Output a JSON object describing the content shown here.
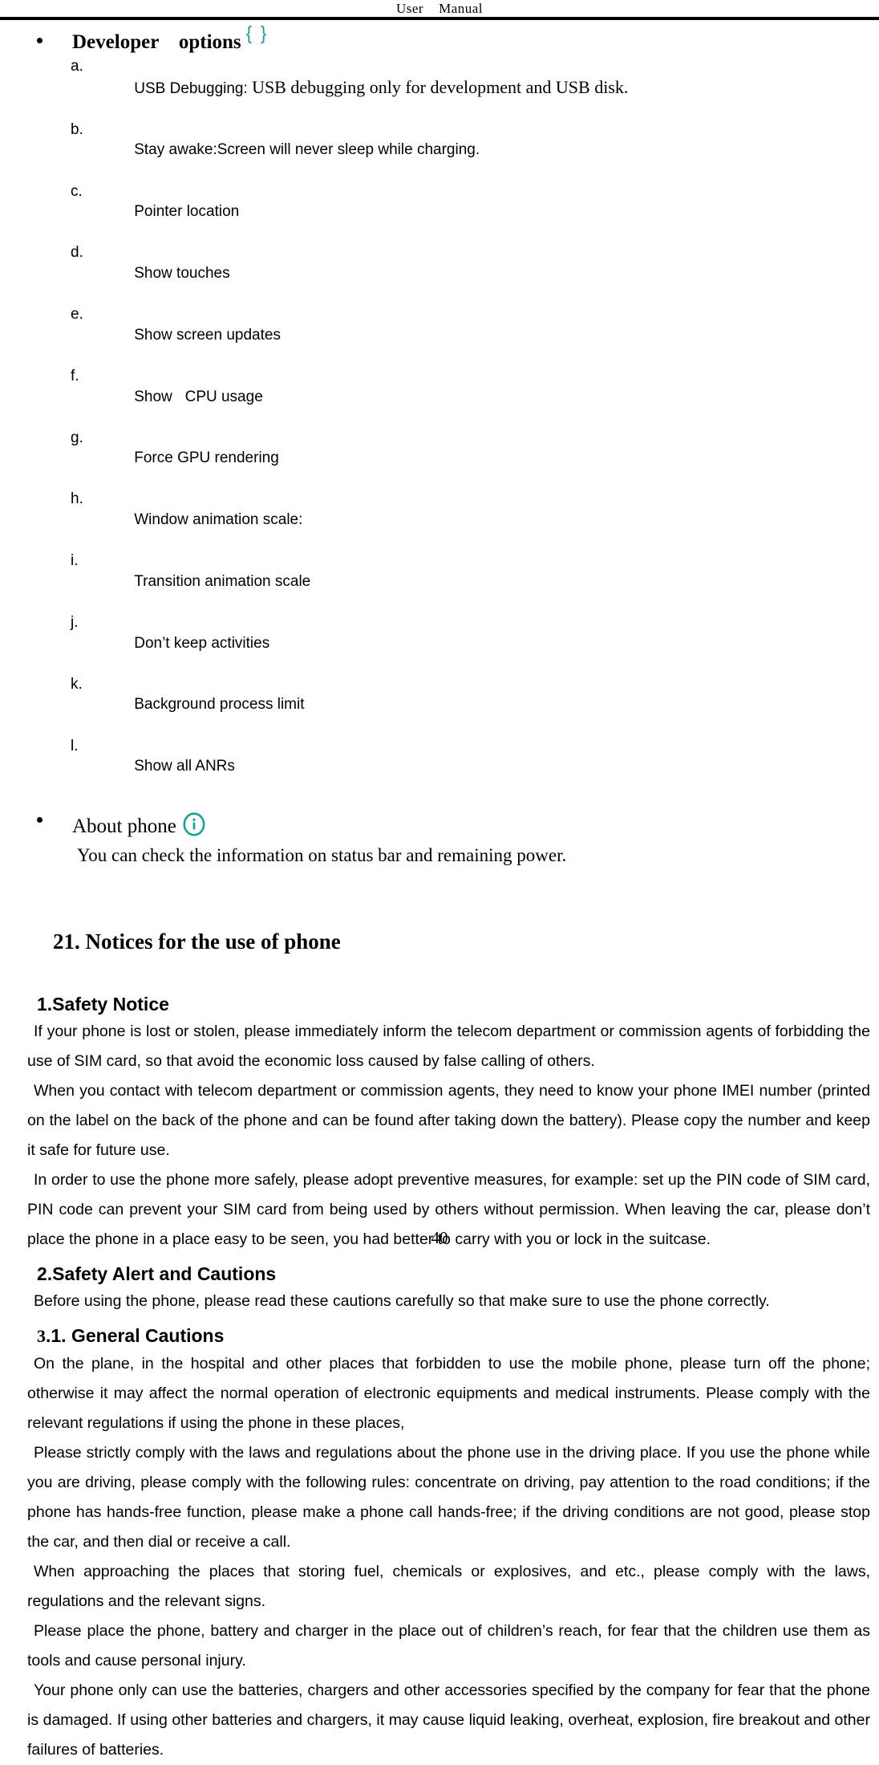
{
  "header": {
    "title": "User    Manual"
  },
  "developer_options": {
    "bullet_label": "Developer    options",
    "icon": "curly-braces-icon",
    "icon_glyph": "{ }",
    "icon_color": "#17a398",
    "items": [
      {
        "marker": "a.",
        "text_bold_part": "USB Debugging: ",
        "text_serif_part": "USB debugging only for development and USB disk."
      },
      {
        "marker": "b.",
        "text_bold_part": "Stay awake:Screen will never sleep while charging.",
        "text_serif_part": ""
      },
      {
        "marker": "c.",
        "text_bold_part": "Pointer location",
        "text_serif_part": ""
      },
      {
        "marker": "d.",
        "text_bold_part": "Show touches",
        "text_serif_part": ""
      },
      {
        "marker": "e.",
        "text_bold_part": "Show screen updates",
        "text_serif_part": ""
      },
      {
        "marker": "f.",
        "text_bold_part": "Show   CPU usage",
        "text_serif_part": ""
      },
      {
        "marker": "g.",
        "text_bold_part": "Force GPU rendering",
        "text_serif_part": ""
      },
      {
        "marker": "h.",
        "text_bold_part": "Window animation scale:",
        "text_serif_part": ""
      },
      {
        "marker": "i.",
        "text_bold_part": "Transition animation scale",
        "text_serif_part": ""
      },
      {
        "marker": "j.",
        "text_bold_part": "Don’t keep activities",
        "text_serif_part": ""
      },
      {
        "marker": "k.",
        "text_bold_part": "Background process limit",
        "text_serif_part": ""
      },
      {
        "marker": "l.",
        "text_bold_part": "Show all ANRs",
        "text_serif_part": ""
      }
    ]
  },
  "about_phone": {
    "bullet_label": "About phone",
    "icon": "info-circle-icon",
    "icon_color": "#17a398",
    "description": "You can check the information on status bar and remaining power."
  },
  "chapter": {
    "heading": "21. Notices for the use of phone"
  },
  "sections": {
    "safety_notice_heading": "1.Safety Notice",
    "safety_notice_p1": "If your phone is lost or stolen, please immediately inform the telecom department or commission agents of forbidding the use of SIM card, so that avoid the economic loss caused by false calling of others.",
    "safety_notice_p2": "When you contact with telecom department or commission agents, they need to know your phone IMEI number (printed on the label on the back of the phone and can be found after taking down the battery). Please copy the number and keep it safe for future use.",
    "safety_notice_p3": "In order to use the phone more safely, please adopt preventive measures, for example: set up the PIN code of SIM card, PIN code can prevent your SIM card from being used by others without permission. When leaving the car, please don’t place the phone in a place easy to be seen, you had better to carry with you or lock in the suitcase.",
    "safety_alert_heading": "2.Safety Alert and Cautions",
    "safety_alert_p1": "Before using the phone, please read these cautions carefully so that make sure to use the phone correctly.",
    "general_cautions_num": "3",
    "general_cautions_rest": ".1. General Cautions",
    "general_cautions_p1": "On the plane, in the hospital and other places that forbidden to use the mobile phone, please turn off the phone; otherwise it may affect the normal operation of electronic equipments and medical instruments. Please comply with the relevant regulations if using the phone in these places,",
    "general_cautions_p2": "Please strictly comply with the laws and regulations about the phone use in the driving place. If you use the phone while you are driving, please comply with the following rules: concentrate on driving, pay attention to the road conditions; if the phone has hands-free function, please make a phone call hands-free; if the driving conditions are not good, please stop the car, and then dial or receive a call.",
    "general_cautions_p3": "When approaching the places that storing fuel, chemicals or explosives, and etc., please comply with the laws, regulations and the relevant signs.",
    "general_cautions_p4": "Please place the phone, battery and charger in the place out of children’s reach, for fear that the children use them as tools and cause personal injury.",
    "general_cautions_p5": "Your phone only can use the batteries, chargers and other accessories specified by the company for fear that the phone is damaged. If using other batteries and chargers, it may cause liquid leaking, overheat, explosion, fire breakout and other failures of batteries."
  },
  "footer": {
    "page_number": "40"
  }
}
